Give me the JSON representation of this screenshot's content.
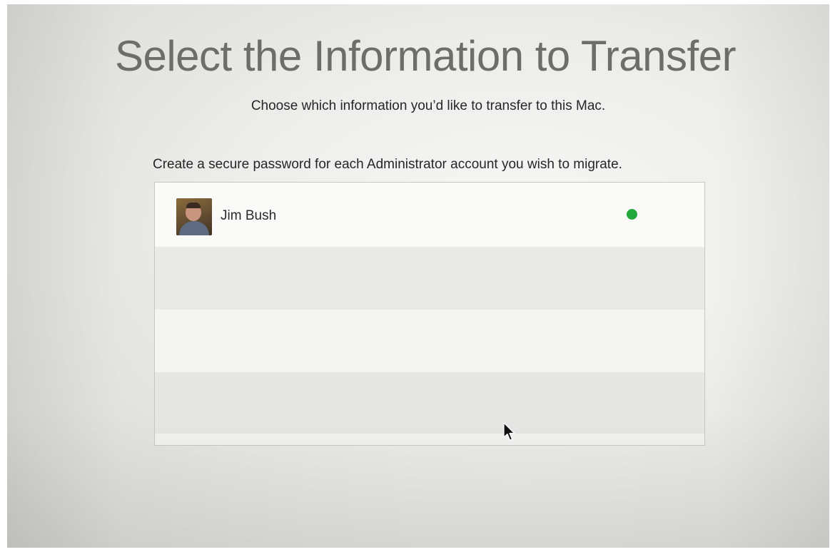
{
  "header": {
    "title": "Select the Information to Transfer",
    "subtitle": "Choose which information you’d like to transfer to this Mac."
  },
  "accounts_section": {
    "instruction": "Create a secure password for each Administrator account you wish to migrate.",
    "accounts": [
      {
        "name": "Jim Bush",
        "avatar": "user-photo",
        "status_icon": "green-status-dot",
        "status_color": "#25a83c"
      }
    ],
    "empty_rows": 3
  },
  "colors": {
    "background": "#ececea",
    "title_text": "#6d6d6b",
    "body_text": "#262626",
    "status_green": "#25a83c"
  },
  "pointer": {
    "icon": "mouse-pointer-icon"
  }
}
